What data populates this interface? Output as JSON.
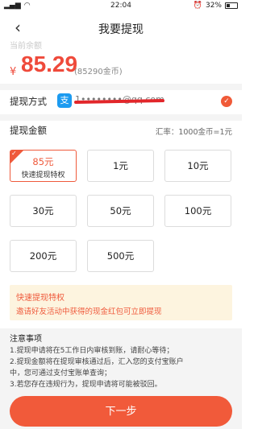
{
  "status_bar": {
    "time": "22:04",
    "battery": "32%"
  },
  "header": {
    "title": "我要提现"
  },
  "balance": {
    "label": "当前余额",
    "currency": "¥",
    "amount": "85.29",
    "coins": "(85290金币)"
  },
  "method": {
    "label": "提现方式",
    "icon": "支",
    "account": "1••••••••@qq.com"
  },
  "withdraw": {
    "label": "提现金额",
    "rate": "汇率：1000金币=1元",
    "options": [
      {
        "value": "85元",
        "sub": "快速提现特权"
      },
      {
        "value": "1元"
      },
      {
        "value": "10元"
      },
      {
        "value": "30元"
      },
      {
        "value": "50元"
      },
      {
        "value": "100元"
      },
      {
        "value": "200元"
      },
      {
        "value": "500元"
      }
    ]
  },
  "notice": {
    "title": "快速提现特权",
    "text": "邀请好友活动中获得的现金红包可立即提现"
  },
  "notes": {
    "title": "注意事项",
    "items": [
      "1.提现申请将在5工作日内审核到账，请耐心等待；",
      "2.提现金额将在提现审核通过后，汇入您的支付宝账户",
      "中，您可通过支付宝账单查询；",
      "3.若您存在违规行为，提现申请将可能被驳回。"
    ]
  },
  "footer": {
    "next_label": "下一步"
  },
  "colors": {
    "accent": "#f15a3a",
    "notice_bg": "#fdf4df",
    "alipay": "#1c9bf0"
  }
}
